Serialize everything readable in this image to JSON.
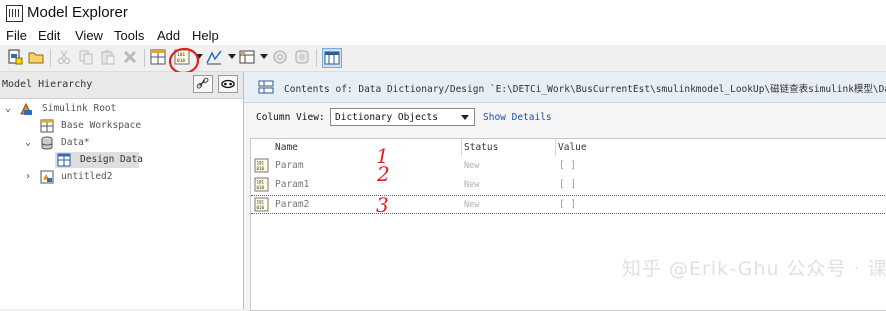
{
  "window": {
    "title": "Model Explorer"
  },
  "menu": [
    "File",
    "Edit",
    "View",
    "Tools",
    "Add",
    "Help"
  ],
  "left_panel": {
    "title": "Model Hierarchy",
    "tree": [
      {
        "label": "Simulink Root",
        "icon": "simulink-root-icon",
        "expanded": true
      },
      {
        "label": "Base Workspace",
        "icon": "workspace-grid-icon"
      },
      {
        "label": "Data*",
        "icon": "database-icon",
        "expanded": true
      },
      {
        "label": "Design Data",
        "icon": "workspace-grid-icon",
        "selected": true
      },
      {
        "label": "untitled2",
        "icon": "model-icon",
        "expanded": false
      }
    ]
  },
  "right_panel": {
    "contents_label": "Contents of: Data Dictionary/Design `E:\\DETCi_Work\\BusCurrentEst\\smulinkmodel_LookUp\\磁链查表simulink模型\\Data.sldd",
    "column_view_label": "Column View:",
    "column_view_value": "Dictionary Objects",
    "show_details": "Show Details",
    "columns": [
      "Name",
      "Status",
      "Value"
    ],
    "rows": [
      {
        "name": "Param",
        "status": "New",
        "value": "[ ]",
        "annotation": "1"
      },
      {
        "name": "Param1",
        "status": "New",
        "value": "[ ]",
        "annotation": "2"
      },
      {
        "name": "Param2",
        "status": "New",
        "value": "[ ]",
        "annotation": "3",
        "selected": true
      }
    ]
  },
  "watermark": "知乎 @Erik-Ghu  公众号 · 课益行",
  "colors": {
    "annotation": "#e02020",
    "link": "#1f4fa8"
  }
}
